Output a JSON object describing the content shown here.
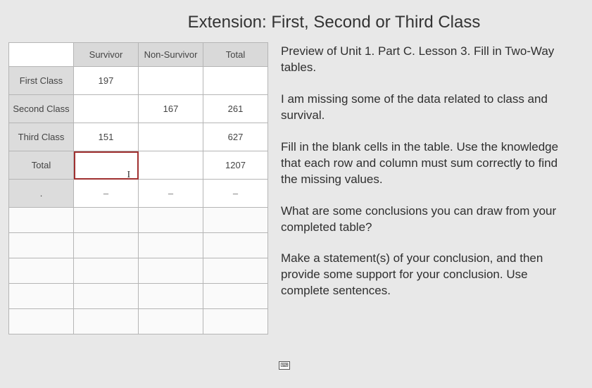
{
  "title": "Extension: First, Second or Third Class",
  "table": {
    "columns": [
      "Survivor",
      "Non-Survivor",
      "Total"
    ],
    "rows": [
      {
        "label": "First Class",
        "values": [
          "197",
          "",
          ""
        ]
      },
      {
        "label": "Second Class",
        "values": [
          "",
          "167",
          "261"
        ]
      },
      {
        "label": "Third Class",
        "values": [
          "151",
          "",
          "627"
        ]
      },
      {
        "label": "Total",
        "values": [
          "",
          "",
          "1207"
        ]
      },
      {
        "label": ".",
        "values": [
          "–",
          "–",
          "–"
        ]
      }
    ]
  },
  "prose": {
    "p1": "Preview of Unit 1. Part C. Lesson 3. Fill in Two-Way tables.",
    "p2": "I am missing some of the data related to class and survival.",
    "p3": "Fill in the blank cells in the table. Use the knowledge that each row and column must sum correctly to find the missing values.",
    "p4": "What are some conclusions you can draw from your completed table?",
    "p5": "Make a statement(s) of your conclusion, and then provide some support for your conclusion. Use complete sentences."
  }
}
